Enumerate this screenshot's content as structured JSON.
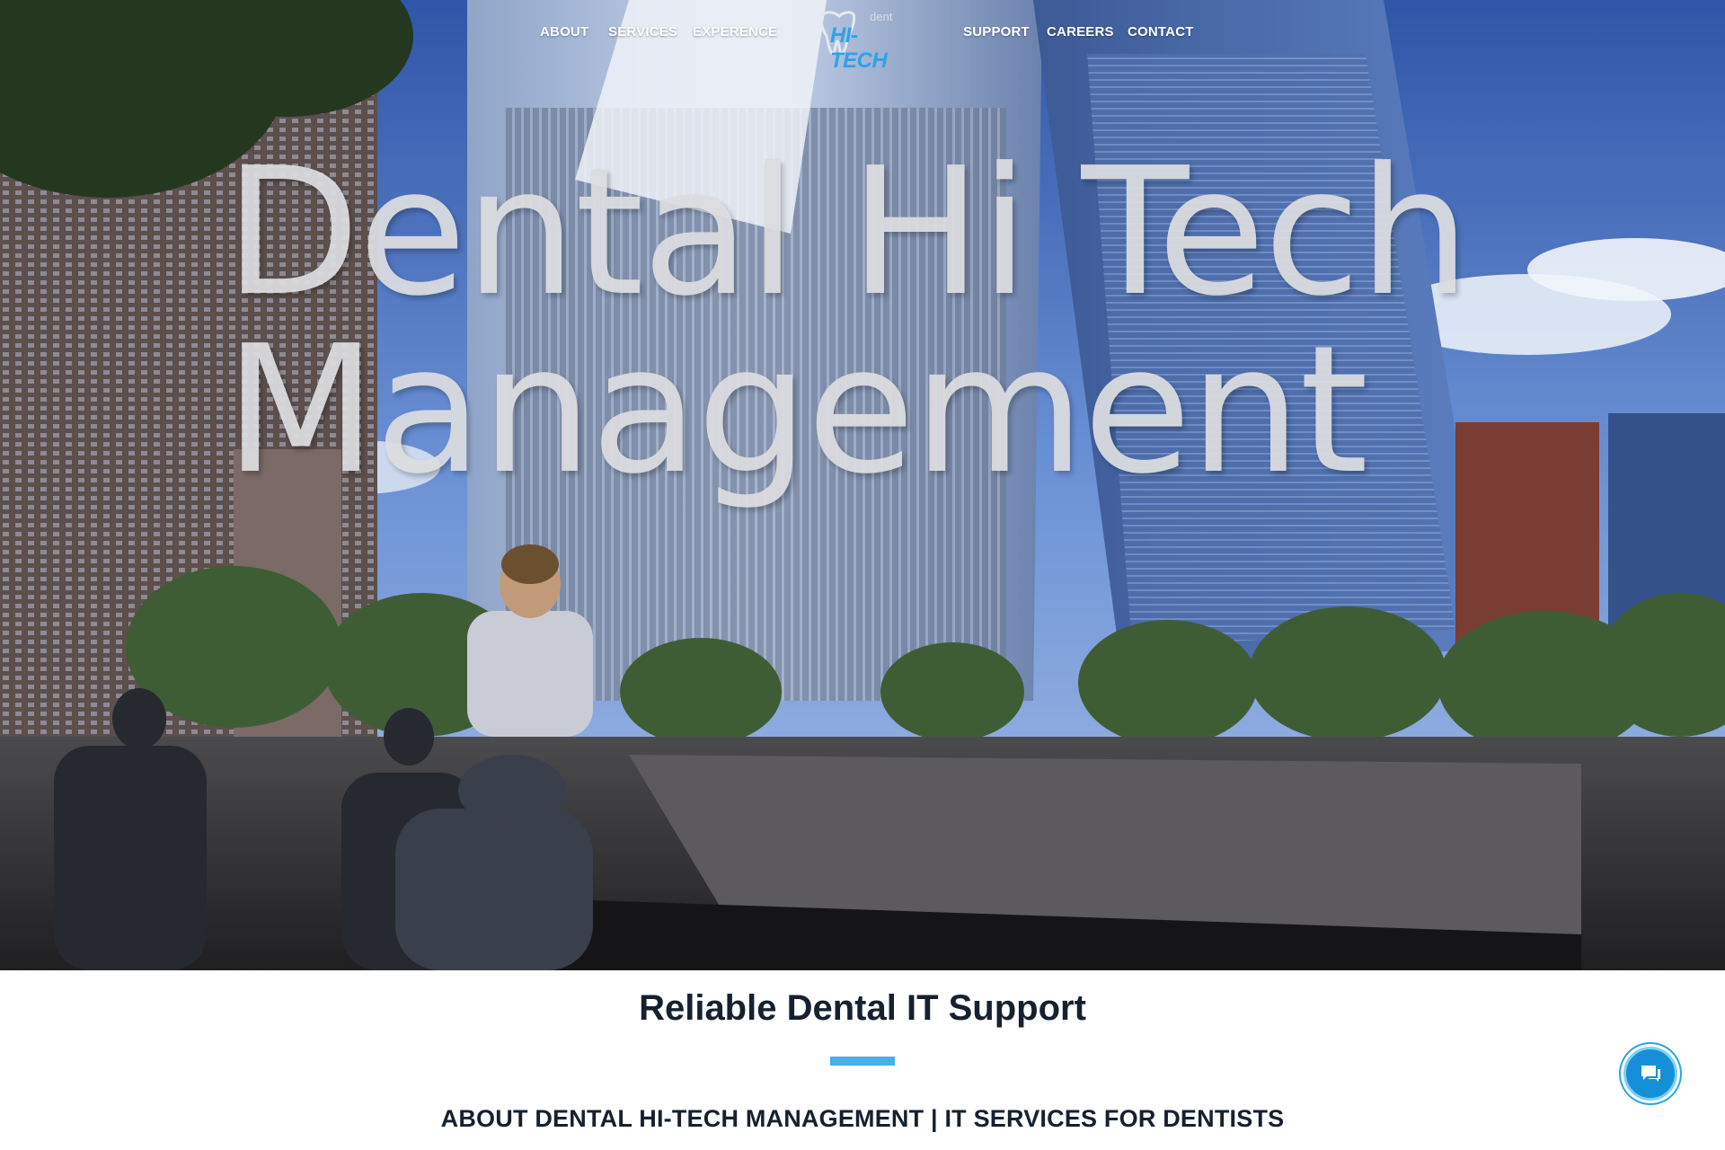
{
  "nav": {
    "left_items": [
      {
        "label": "ABOUT"
      },
      {
        "label": "SERVICES"
      },
      {
        "label": "EXPERENCE"
      }
    ],
    "right_items": [
      {
        "label": "SUPPORT"
      },
      {
        "label": "CAREERS"
      },
      {
        "label": "CONTACT"
      }
    ]
  },
  "logo": {
    "small_text": "dent",
    "main_text": "HI-TECH",
    "brand_color": "#2ea2e6"
  },
  "hero": {
    "title_line1": "Dental Hi Tech",
    "title_line2": "Management"
  },
  "content": {
    "heading": "Reliable Dental IT Support",
    "subheading": "ABOUT DENTAL HI-TECH MANAGEMENT | IT SERVICES FOR DENTISTS",
    "accent_color": "#4aaee8"
  },
  "chat": {
    "icon": "chat-bubbles-icon"
  }
}
